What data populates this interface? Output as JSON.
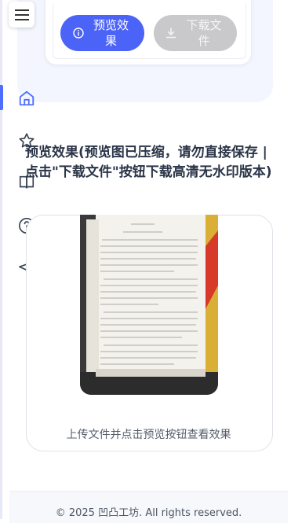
{
  "nav": {
    "menu_icon": "hamburger-icon",
    "items": [
      {
        "icon": "home-icon",
        "active": true
      },
      {
        "icon": "star-icon",
        "active": false
      },
      {
        "icon": "book-icon",
        "active": false
      },
      {
        "icon": "help-circle-icon",
        "active": false
      },
      {
        "icon": "send-icon",
        "active": false
      }
    ]
  },
  "actions": {
    "preview_label": "预览效果",
    "preview_icon": "info-circle-icon",
    "download_label": "下载文件",
    "download_icon": "download-icon",
    "download_enabled": false
  },
  "preview": {
    "title": "预览效果(预览图已压缩，请勿直接保存 | 点击\"下载文件\"按钮下载高清无水印版本)",
    "caption": "上传文件并点击预览按钮查看效果"
  },
  "footer": {
    "copyright": "© 2025 凹凸工坊. All rights reserved."
  },
  "colors": {
    "primary": "#4b63f7",
    "disabled": "#c9c9cc",
    "nav_icon": "#4c6fff"
  }
}
